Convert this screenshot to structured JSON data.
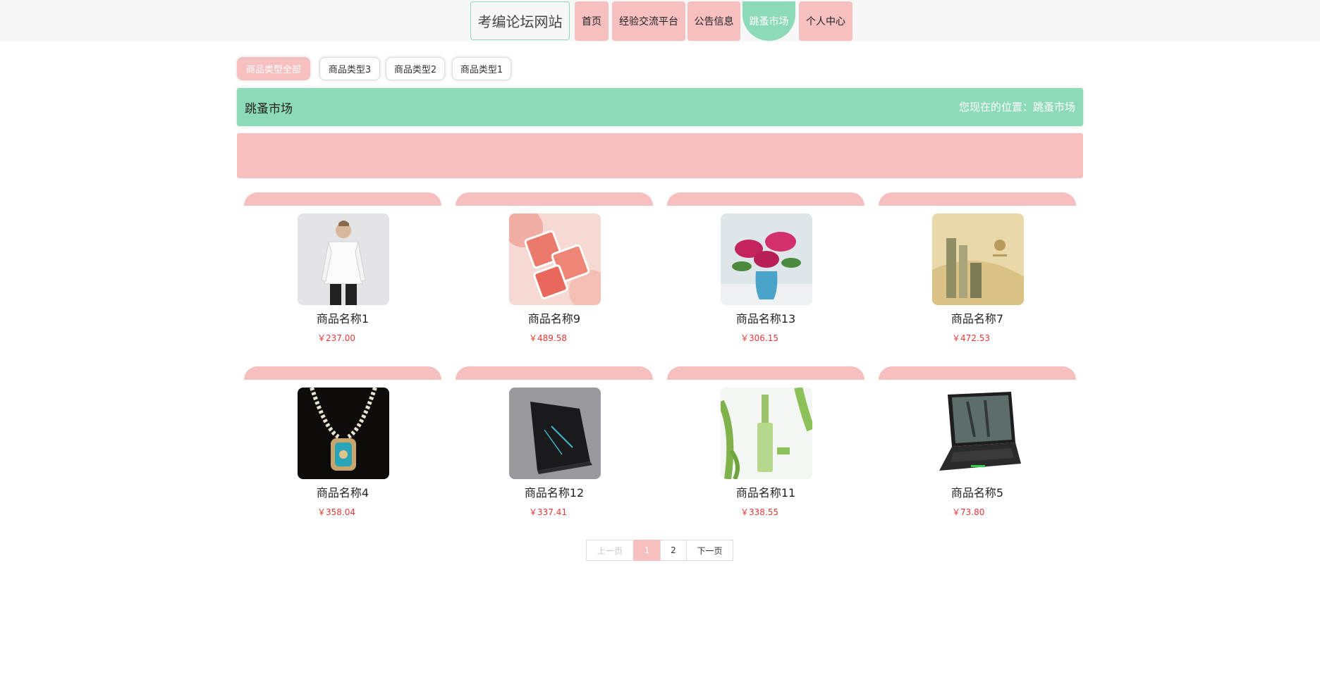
{
  "nav": {
    "site_title": "考编论坛网站",
    "items": [
      "首页",
      "经验交流平台",
      "公告信息",
      "跳蚤市场",
      "个人中心"
    ],
    "active": "跳蚤市场"
  },
  "categories": [
    "商品类型全部",
    "商品类型3",
    "商品类型2",
    "商品类型1"
  ],
  "breadcrumb": {
    "title": "跳蚤市场",
    "location": "您现在的位置：跳蚤市场"
  },
  "products": [
    {
      "name": "商品名称1",
      "price": "￥237.00",
      "icon": "white-shirt-model-photo"
    },
    {
      "name": "商品名称9",
      "price": "￥489.58",
      "icon": "blush-compact-photo"
    },
    {
      "name": "商品名称13",
      "price": "￥306.15",
      "icon": "lily-vase-photo"
    },
    {
      "name": "商品名称7",
      "price": "￥472.53",
      "icon": "cosmetics-set-photo"
    },
    {
      "name": "商品名称4",
      "price": "￥358.04",
      "icon": "jade-pendant-necklace-photo"
    },
    {
      "name": "商品名称12",
      "price": "￥337.41",
      "icon": "black-laptop-photo"
    },
    {
      "name": "商品名称11",
      "price": "￥338.55",
      "icon": "green-skincare-photo"
    },
    {
      "name": "商品名称5",
      "price": "￥73.80",
      "icon": "gaming-laptop-photo"
    }
  ],
  "pagination": {
    "prev": "上一页",
    "pages": [
      "1",
      "2"
    ],
    "current": "1",
    "next": "下一页"
  },
  "colors": {
    "pink": "#f6bfc0",
    "mint": "#8ddab8",
    "price_red": "#e53935"
  }
}
